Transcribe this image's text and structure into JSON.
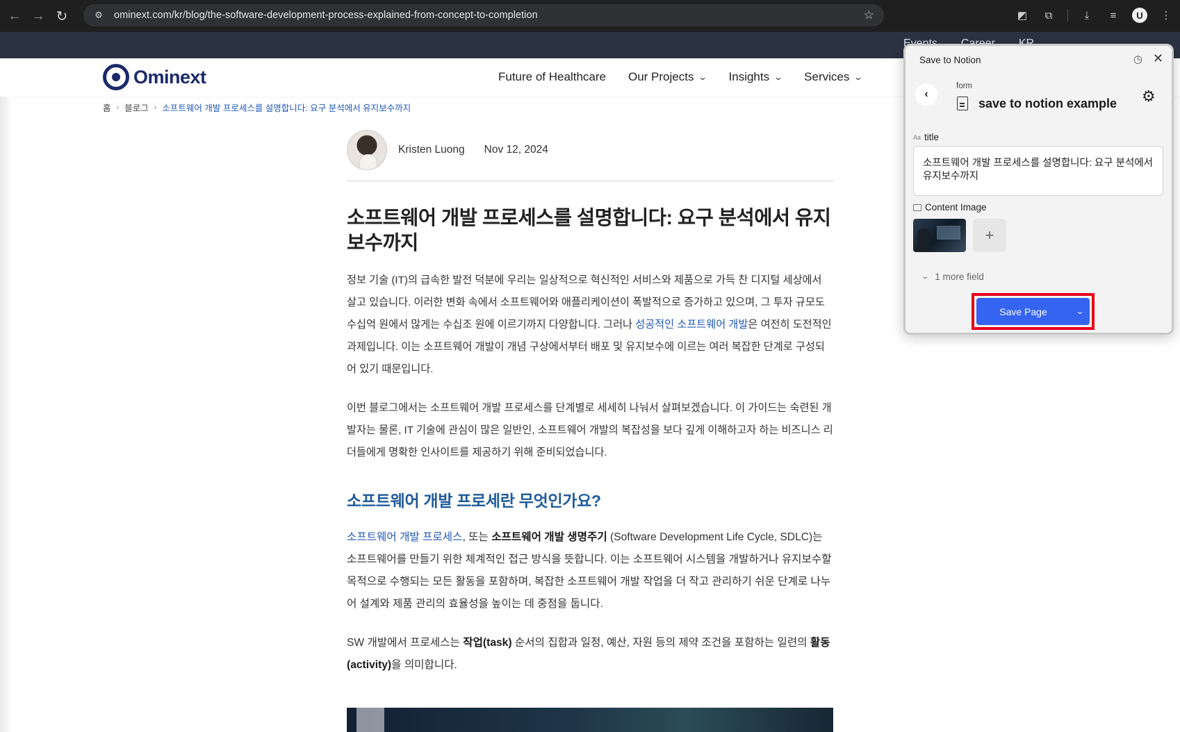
{
  "browser": {
    "url": "ominext.com/kr/blog/the-software-development-process-explained-from-concept-to-completion",
    "profile_initial": "U"
  },
  "topbar": {
    "links": [
      "Events",
      "Career",
      "KR"
    ]
  },
  "site": {
    "logo": "Ominext",
    "menu": [
      "Future of Healthcare",
      "Our Projects",
      "Insights",
      "Services"
    ]
  },
  "breadcrumb": {
    "home": "홈",
    "blog": "블로그",
    "current": "소프트웨어 개발 프로세스를 설명합니다: 요구 분석에서 유지보수까지"
  },
  "author": {
    "name": "Kristen Luong",
    "date": "Nov 12, 2024"
  },
  "article": {
    "title": "소프트웨어 개발 프로세스를 설명합니다: 요구 분석에서 유지보수까지",
    "p1_a": "정보 기술 (IT)의 급속한 발전 덕분에 우리는 일상적으로 혁신적인 서비스와 제품으로 가득 찬 디지털 세상에서 살고 있습니다. 이러한 변화 속에서 소프트웨어와 애플리케이션이 폭발적으로 증가하고 있으며, 그 투자 규모도 수십억 원에서 많게는 수십조 원에 이르기까지 다양합니다. 그러나 ",
    "p1_link": "성공적인 소프트웨어 개발",
    "p1_b": "은 여전히 도전적인 과제입니다. 이는 소프트웨어 개발이 개념 구상에서부터 배포 및 유지보수에 이르는 여러 복잡한 단계로 구성되어 있기 때문입니다.",
    "p2": "이번 블로그에서는 소프트웨어 개발 프로세스를 단계별로 세세히 나눠서 살펴보겠습니다. 이 가이드는 숙련된 개발자는 물론, IT 기술에 관심이 많은 일반인, 소프트웨어 개발의 복잡성을 보다 깊게 이해하고자 하는 비즈니스 리더들에게 명확한 인사이트를 제공하기 위해 준비되었습니다.",
    "h2": "소프트웨어 개발 프로세란 무엇인가요?",
    "p3_link": "소프트웨어 개발 프로세스",
    "p3_mid": ", 또는 ",
    "p3_bold": "소프트웨어 개발 생명주기",
    "p3_rest": " (Software Development Life Cycle, SDLC)는 소프트웨어를 만들기 위한 체계적인 접근 방식을 뜻합니다. 이는 소프트웨어 시스템을 개발하거나 유지보수할 목적으로 수행되는 모든 활동을 포함하며, 복잡한 소프트웨어 개발 작업을 더 작고 관리하기 쉬운 단계로 나누어 설계와 제품 관리의 효율성을 높이는 데 중점을 둡니다.",
    "p4_a": "SW 개발에서 프로세스는 ",
    "p4_bold1": "작업(task)",
    "p4_b": " 순서의 집합과 일정, 예산, 자원 등의 제약 조건을 포함하는 일련의 ",
    "p4_bold2": "활동 (activity)",
    "p4_c": "을 의미합니다."
  },
  "notion": {
    "header_title": "Save to Notion",
    "form_kind": "form",
    "form_name": "save to notion example",
    "title_label": "title",
    "title_value": "소프트웨어 개발 프로세스를 설명합니다: 요구 분석에서 유지보수까지",
    "image_label": "Content Image",
    "more_fields": "1 more field",
    "save_label": "Save Page"
  }
}
